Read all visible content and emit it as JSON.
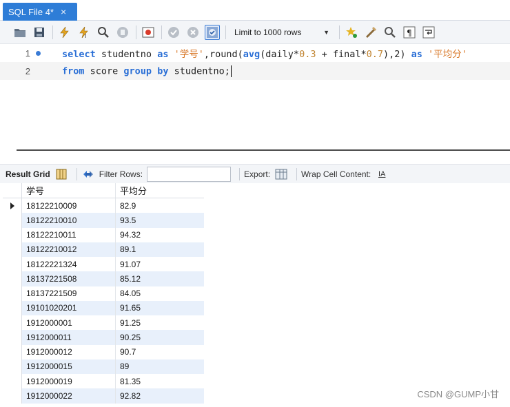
{
  "tab": {
    "title": "SQL File 4*",
    "close": "×"
  },
  "toolbar": {
    "limit_label": "Limit to 1000 rows"
  },
  "editor": {
    "line1": {
      "num": "1",
      "t1": "select",
      "t2": " studentno ",
      "t3": "as",
      "t4": " ",
      "t5": "'学号'",
      "t6": ",round(",
      "t7": "avg",
      "t8": "(daily*",
      "t9": "0.3",
      "t10": " + final*",
      "t11": "0.7",
      "t12": "),2) ",
      "t13": "as",
      "t14": " ",
      "t15": "'平均分'"
    },
    "line2": {
      "num": "2",
      "t1": "from",
      "t2": " score ",
      "t3": "group",
      "t4": " ",
      "t5": "by",
      "t6": " studentno;"
    }
  },
  "result_toolbar": {
    "result_grid": "Result Grid",
    "filter_rows": "Filter Rows:",
    "export": "Export:",
    "wrap": "Wrap Cell Content:",
    "wrap_icon": "IA"
  },
  "grid": {
    "headers": [
      "学号",
      "平均分"
    ],
    "rows": [
      [
        "18122210009",
        "82.9"
      ],
      [
        "18122210010",
        "93.5"
      ],
      [
        "18122210011",
        "94.32"
      ],
      [
        "18122210012",
        "89.1"
      ],
      [
        "18122221324",
        "91.07"
      ],
      [
        "18137221508",
        "85.12"
      ],
      [
        "18137221509",
        "84.05"
      ],
      [
        "19101020201",
        "91.65"
      ],
      [
        "1912000001",
        "91.25"
      ],
      [
        "1912000011",
        "90.25"
      ],
      [
        "1912000012",
        "90.7"
      ],
      [
        "1912000015",
        "89"
      ],
      [
        "1912000019",
        "81.35"
      ],
      [
        "1912000022",
        "92.82"
      ]
    ]
  },
  "watermark": "CSDN @GUMP小甘",
  "colors": {
    "tab": "#2e7dd7",
    "keyword": "#2a6fd6",
    "string": "#d97a2b",
    "row_alt": "#e8f0fb"
  }
}
